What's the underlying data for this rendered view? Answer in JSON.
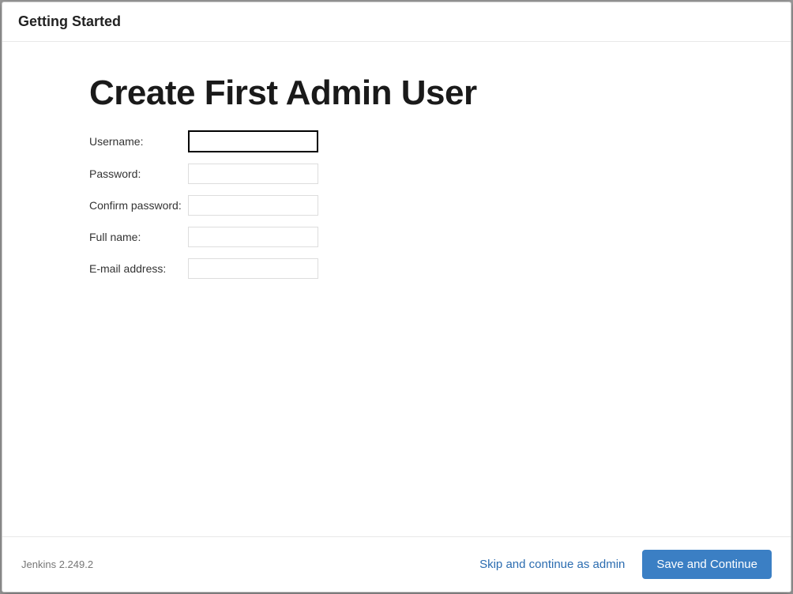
{
  "header": {
    "title": "Getting Started"
  },
  "main": {
    "title": "Create First Admin User",
    "fields": {
      "username": {
        "label": "Username:",
        "value": ""
      },
      "password": {
        "label": "Password:",
        "value": ""
      },
      "confirm": {
        "label": "Confirm password:",
        "value": ""
      },
      "fullname": {
        "label": "Full name:",
        "value": ""
      },
      "email": {
        "label": "E-mail address:",
        "value": ""
      }
    }
  },
  "footer": {
    "version": "Jenkins 2.249.2",
    "skip_label": "Skip and continue as admin",
    "save_label": "Save and Continue"
  }
}
